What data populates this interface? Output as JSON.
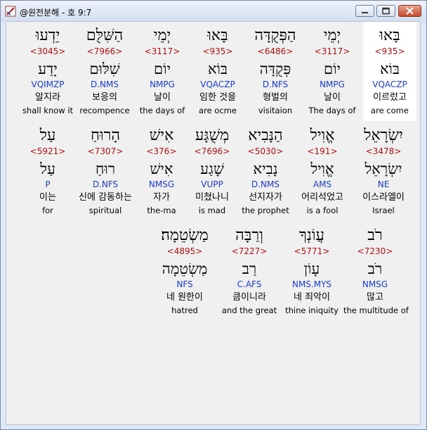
{
  "window": {
    "title": "@원전분해 - 호 9:7",
    "icons": {
      "app": "pen-diagonal-icon",
      "minimize": "minimize-icon",
      "maximize": "maximize-icon",
      "close": "close-icon"
    }
  },
  "rows": [
    {
      "words": [
        {
          "hebrew": "בָּאוּ",
          "strong": "<935>",
          "lemma": "בּוֹא",
          "parsing": "VQACZP",
          "korean": "이르렀고",
          "english": "are come",
          "highlight": true
        },
        {
          "hebrew": "יְמֵי",
          "strong": "<3117>",
          "lemma": "יוֹם",
          "parsing": "NMPG",
          "korean": "날이",
          "english": "The days of"
        },
        {
          "hebrew": "הַפְּקֻדָּה",
          "strong": "<6486>",
          "lemma": "פְּקֻדָּה",
          "parsing": "D.NFS",
          "korean": "형벌의",
          "english": "visitaion"
        },
        {
          "hebrew": "בָּאוּ",
          "strong": "<935>",
          "lemma": "בּוֹא",
          "parsing": "VQACZP",
          "korean": "임한 것을",
          "english": "are ocme"
        },
        {
          "hebrew": "יְמֵי",
          "strong": "<3117>",
          "lemma": "יוֹם",
          "parsing": "NMPG",
          "korean": "날이",
          "english": "the days of"
        },
        {
          "hebrew": "הַשִּׁלֻּם",
          "strong": "<7966>",
          "lemma": "שִׁלּוּם",
          "parsing": "D.NMS",
          "korean": "보응의",
          "english": "recompence"
        },
        {
          "hebrew": "יֵדְעוּ",
          "strong": "<3045>",
          "lemma": "יָדַע",
          "parsing": "VQIMZP",
          "korean": "알지라",
          "english": "shall know it"
        }
      ]
    },
    {
      "words": [
        {
          "hebrew": "יִשְׂרָאֵל",
          "strong": "<3478>",
          "lemma": "יִשְׂרָאֵל",
          "parsing": "NE",
          "korean": "이스라엘이",
          "english": "Israel"
        },
        {
          "hebrew": "אֱוִיל",
          "strong": "<191>",
          "lemma": "אֱוִיל",
          "parsing": "AMS",
          "korean": "어리석었고",
          "english": "is a fool"
        },
        {
          "hebrew": "הַנָּבִיא",
          "strong": "<5030>",
          "lemma": "נָבִיא",
          "parsing": "D.NMS",
          "korean": "선지자가",
          "english": "the prophet"
        },
        {
          "hebrew": "מְשֻׁגָּע",
          "strong": "<7696>",
          "lemma": "שָׁגַע",
          "parsing": "VUPP",
          "korean": "미쳤나니",
          "english": "is mad"
        },
        {
          "hebrew": "אִישׁ",
          "strong": "<376>",
          "lemma": "אִישׁ",
          "parsing": "NMSG",
          "korean": "자가",
          "english": "the-ma"
        },
        {
          "hebrew": "הָרוּחַ",
          "strong": "<7307>",
          "lemma": "רוּחַ",
          "parsing": "D.NFS",
          "korean": "신에 감동하는",
          "english": "spiritual"
        },
        {
          "hebrew": "עַל",
          "strong": "<5921>",
          "lemma": "עַל",
          "parsing": "P",
          "korean": "이는",
          "english": "for"
        }
      ]
    },
    {
      "words": [
        {
          "hebrew": "רֹב",
          "strong": "<7230>",
          "lemma": "רֹב",
          "parsing": "NMSG",
          "korean": "많고",
          "english": "the multitude of"
        },
        {
          "hebrew": "עֲוֹנְךָ",
          "strong": "<5771>",
          "lemma": "עָוֹן",
          "parsing": "NMS.MYS",
          "korean": "네 죄악이",
          "english": "thine iniquity"
        },
        {
          "hebrew": "וְרַבָּה",
          "strong": "<7227>",
          "lemma": "רַב",
          "parsing": "C.AFS",
          "korean": "큼이니라",
          "english": "and the great"
        },
        {
          "hebrew": "מַשְׂטֵמָה׃",
          "strong": "<4895>",
          "lemma": "מַשְׂטֵמָה",
          "parsing": "NFS",
          "korean": "네 원한이",
          "english": "hatred"
        }
      ]
    }
  ]
}
